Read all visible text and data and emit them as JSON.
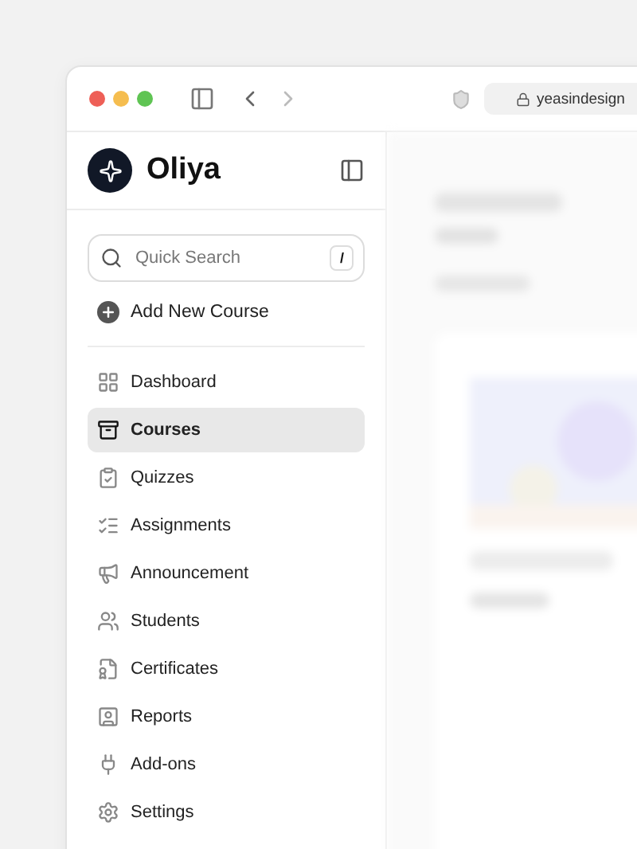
{
  "browser": {
    "url": "yeasindesign"
  },
  "sidebar": {
    "brand": "Oliya",
    "search": {
      "placeholder": "Quick Search",
      "shortcut": "/"
    },
    "add_button": "Add New Course",
    "items": [
      {
        "label": "Dashboard",
        "selected": false
      },
      {
        "label": "Courses",
        "selected": true
      },
      {
        "label": "Quizzes",
        "selected": false
      },
      {
        "label": "Assignments",
        "selected": false
      },
      {
        "label": "Announcement",
        "selected": false
      },
      {
        "label": "Students",
        "selected": false
      },
      {
        "label": "Certificates",
        "selected": false
      },
      {
        "label": "Reports",
        "selected": false
      },
      {
        "label": "Add-ons",
        "selected": false
      },
      {
        "label": "Settings",
        "selected": false
      }
    ]
  }
}
